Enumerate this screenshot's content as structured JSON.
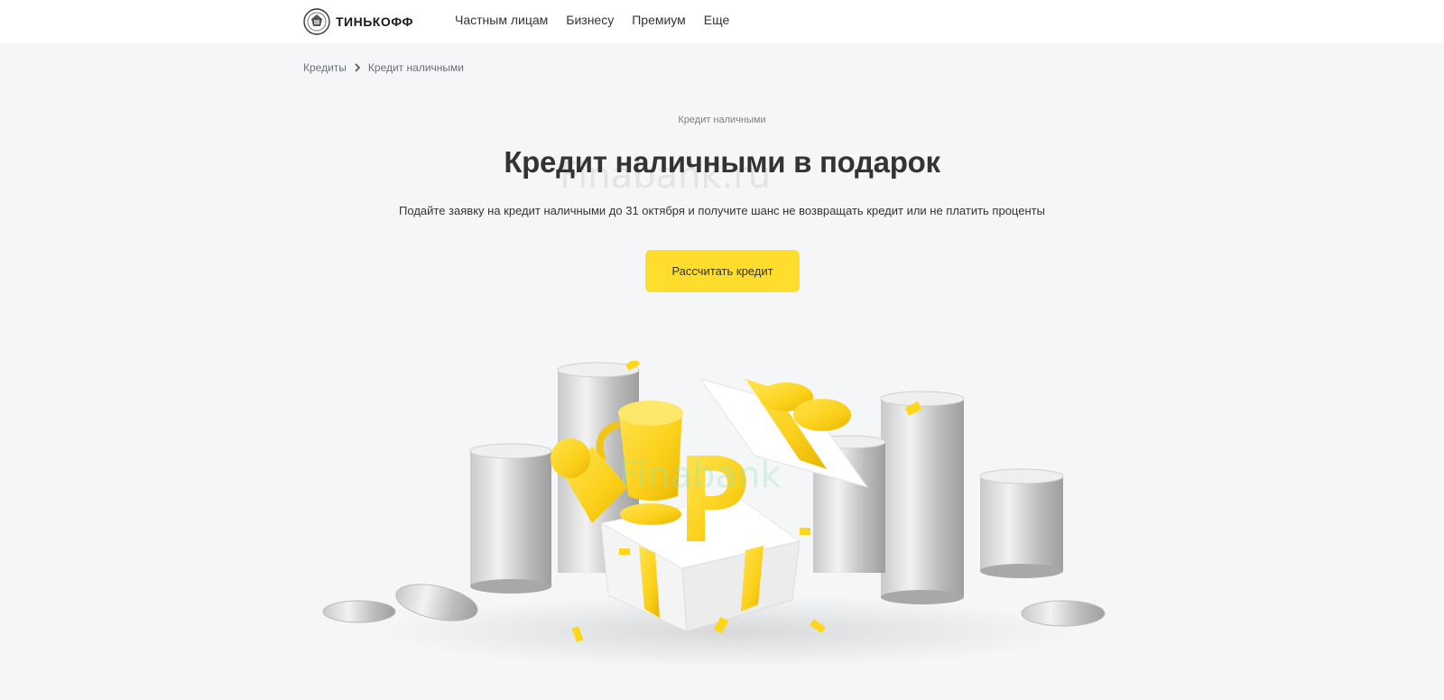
{
  "header": {
    "brand": "ТИНЬКОФФ",
    "nav": [
      {
        "label": "Частным лицам"
      },
      {
        "label": "Бизнесу"
      },
      {
        "label": "Премиум"
      },
      {
        "label": "Еще"
      }
    ]
  },
  "breadcrumb": {
    "items": [
      "Кредиты",
      "Кредит наличными"
    ]
  },
  "hero": {
    "eyebrow": "Кредит наличными",
    "title": "Кредит наличными в подарок",
    "watermark": "Finabank.ru",
    "subtitle": "Подайте заявку на кредит наличными до 31 октября и получите шанс не возвращать кредит или не платить проценты",
    "cta_label": "Рассчитать кредит"
  },
  "illustration": {
    "watermark": "Finabank"
  },
  "colors": {
    "accent": "#ffdd2d",
    "page_bg": "#f5f6f8",
    "header_bg": "#ffffff",
    "text": "#333333"
  },
  "icons": [
    "tinkoff-emblem-icon",
    "chevron-right-icon"
  ]
}
